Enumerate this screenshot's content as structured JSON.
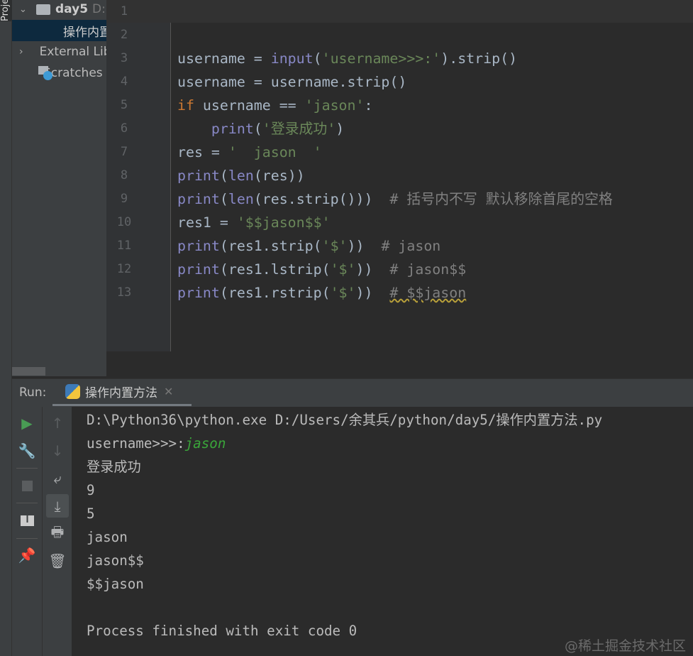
{
  "project_panel": {
    "label": "Project",
    "items": [
      {
        "label": "day5",
        "suffix": "D:",
        "icon": "folder-icon",
        "expanded": true
      },
      {
        "label": "操作内置方法.py",
        "icon": "python-file-icon",
        "selected": true
      },
      {
        "label": "External Libraries",
        "icon": "library-icon"
      },
      {
        "label": "Scratches and Consoles",
        "icon": "scratches-icon"
      }
    ]
  },
  "editor": {
    "line_numbers": [
      "1",
      "2",
      "3",
      "4",
      "5",
      "6",
      "7",
      "8",
      "9",
      "10",
      "11",
      "12",
      "13"
    ],
    "lines": [
      [],
      [],
      [
        [
          "username = ",
          "pl"
        ],
        [
          "input",
          "fn"
        ],
        [
          "(",
          "pl"
        ],
        [
          "'username>>>:'",
          "str"
        ],
        [
          ").strip()",
          "pl"
        ]
      ],
      [
        [
          "username = username.strip()",
          "pl"
        ]
      ],
      [
        [
          "if",
          "kw"
        ],
        [
          " username == ",
          "pl"
        ],
        [
          "'jason'",
          "str"
        ],
        [
          ":",
          "pl"
        ]
      ],
      [
        [
          "    ",
          "pl"
        ],
        [
          "print",
          "fn"
        ],
        [
          "(",
          "pl"
        ],
        [
          "'登录成功'",
          "str"
        ],
        [
          ")",
          "pl"
        ]
      ],
      [
        [
          "res = ",
          "pl"
        ],
        [
          "'  jason  '",
          "str"
        ]
      ],
      [
        [
          "print",
          "fn"
        ],
        [
          "(",
          "pl"
        ],
        [
          "len",
          "fn"
        ],
        [
          "(res))",
          "pl"
        ]
      ],
      [
        [
          "print",
          "fn"
        ],
        [
          "(",
          "pl"
        ],
        [
          "len",
          "fn"
        ],
        [
          "(res.strip()))  ",
          "pl"
        ],
        [
          "# 括号内不写 默认移除首尾的空格",
          "cm"
        ]
      ],
      [
        [
          "res1 = ",
          "pl"
        ],
        [
          "'$$jason$$'",
          "str"
        ]
      ],
      [
        [
          "print",
          "fn"
        ],
        [
          "(res1.strip(",
          "pl"
        ],
        [
          "'$'",
          "str"
        ],
        [
          "))  ",
          "pl"
        ],
        [
          "# jason",
          "cm"
        ]
      ],
      [
        [
          "print",
          "fn"
        ],
        [
          "(res1.lstrip(",
          "pl"
        ],
        [
          "'$'",
          "str"
        ],
        [
          "))  ",
          "pl"
        ],
        [
          "# jason$$",
          "cm"
        ]
      ],
      [
        [
          "print",
          "fn"
        ],
        [
          "(res1.rstrip(",
          "pl"
        ],
        [
          "'$'",
          "str"
        ],
        [
          "))  ",
          "pl"
        ],
        [
          "# $$jason",
          "cm warn"
        ]
      ]
    ]
  },
  "run_panel": {
    "label": "Run:",
    "tab": "操作内置方法",
    "output": [
      [
        [
          "D:\\Python36\\python.exe D:/Users/余其兵/python/day5/操作内置方法.py",
          ""
        ]
      ],
      [
        [
          "username>>>:",
          ""
        ],
        [
          "jason",
          "input"
        ]
      ],
      [
        [
          "登录成功",
          ""
        ]
      ],
      [
        [
          "9",
          ""
        ]
      ],
      [
        [
          "5",
          ""
        ]
      ],
      [
        [
          "jason",
          ""
        ]
      ],
      [
        [
          "jason$$",
          ""
        ]
      ],
      [
        [
          "$$jason",
          ""
        ]
      ],
      [
        [
          "",
          ""
        ]
      ],
      [
        [
          "Process finished with exit code 0",
          ""
        ]
      ]
    ]
  },
  "watermark": "@稀土掘金技术社区",
  "colors": {
    "keyword": "#cc7832",
    "builtin": "#8888c6",
    "string": "#6a8759",
    "comment": "#808080",
    "input": "#3aa63a",
    "run": "#499c54"
  }
}
